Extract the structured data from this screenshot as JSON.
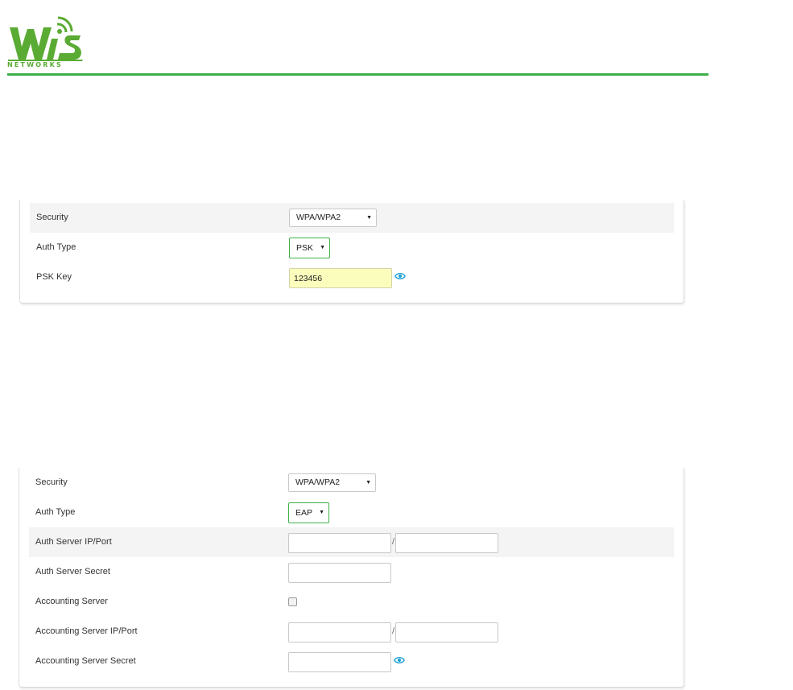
{
  "brand": {
    "logo_text": "WiS",
    "logo_subtext": "NETWORKS",
    "logo_color": "#5aab33",
    "rule_color": "#3dae49"
  },
  "psk_form": {
    "security": {
      "label": "Security",
      "value": "WPA/WPA2"
    },
    "auth_type": {
      "label": "Auth Type",
      "value": "PSK"
    },
    "psk_key": {
      "label": "PSK Key",
      "value": "123456"
    }
  },
  "eap_form": {
    "security": {
      "label": "Security",
      "value": "WPA/WPA2"
    },
    "auth_type": {
      "label": "Auth Type",
      "value": "EAP"
    },
    "auth_server_ip_port": {
      "label": "Auth Server IP/Port",
      "ip": "",
      "port": "",
      "separator": "/"
    },
    "auth_server_secret": {
      "label": "Auth Server Secret",
      "value": ""
    },
    "accounting_server": {
      "label": "Accounting Server",
      "checked": false
    },
    "accounting_server_ip_port": {
      "label": "Accounting Server IP/Port",
      "ip": "",
      "port": "",
      "separator": "/"
    },
    "accounting_server_secret": {
      "label": "Accounting Server Secret",
      "value": ""
    }
  },
  "icons": {
    "eye": "eye-icon",
    "caret": "caret-down-icon"
  },
  "colors": {
    "focus_border": "#3fb047",
    "autofill_bg": "#fbfdbc",
    "eye_icon": "#1a9fd6"
  }
}
